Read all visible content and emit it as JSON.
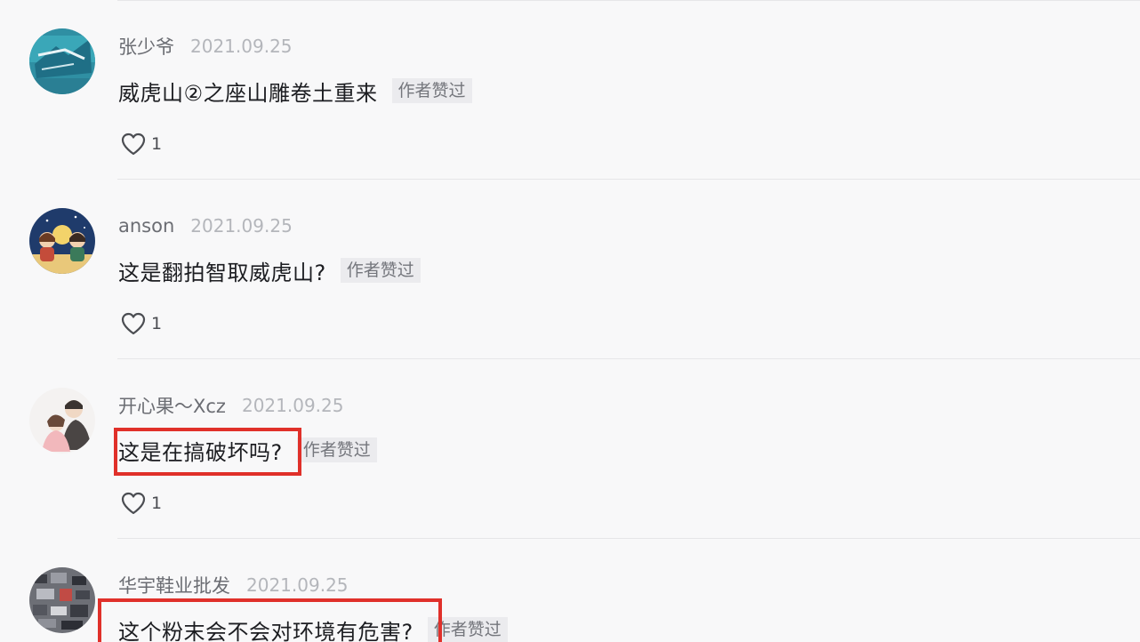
{
  "comments": [
    {
      "username": "张少爷",
      "date": "2021.09.25",
      "text": "威虎山②之座山雕卷土重来",
      "badge": "作者赞过",
      "likes": "1",
      "highlighted": false
    },
    {
      "username": "anson",
      "date": "2021.09.25",
      "text": "这是翻拍智取威虎山?",
      "badge": "作者赞过",
      "likes": "1",
      "highlighted": false
    },
    {
      "username": "开心果～Xcz",
      "date": "2021.09.25",
      "text": "这是在搞破坏吗?",
      "badge": "作者赞过",
      "likes": "1",
      "highlighted": true
    },
    {
      "username": "华宇鞋业批发",
      "date": "2021.09.25",
      "text": "这个粉末会不会对环境有危害?",
      "badge": "作者赞过",
      "likes": "",
      "highlighted": true
    }
  ],
  "icons": {
    "like": "heart-outline-icon"
  },
  "colors": {
    "highlight_border": "#e0302a",
    "badge_bg": "#ebebee",
    "page_bg": "#f8f8f9"
  }
}
